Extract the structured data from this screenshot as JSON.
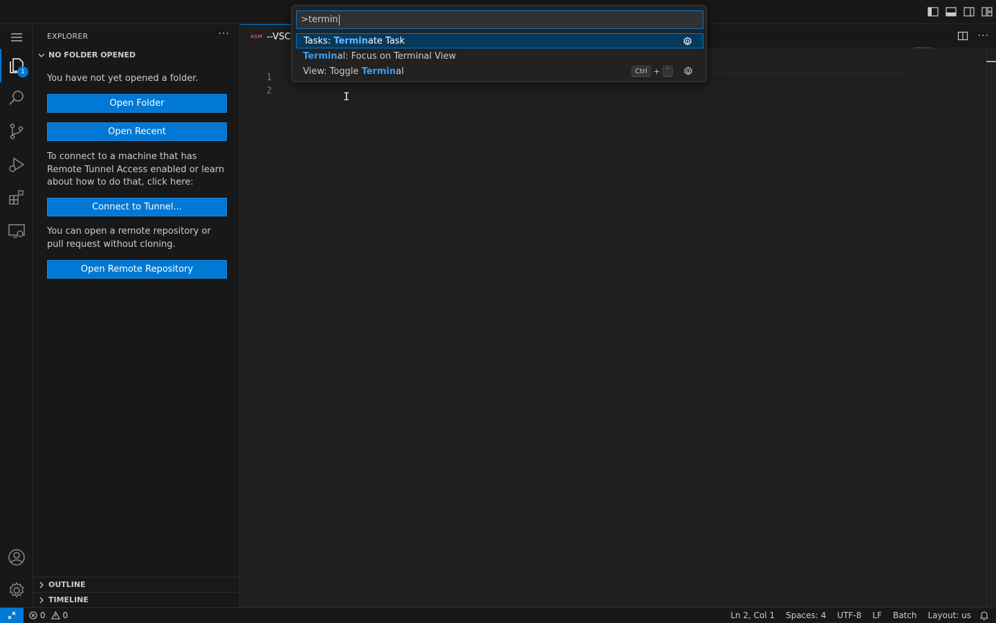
{
  "sidebar": {
    "title": "EXPLORER",
    "section_title": "NO FOLDER OPENED",
    "no_folder_text": "You have not yet opened a folder.",
    "open_folder_label": "Open Folder",
    "open_recent_label": "Open Recent",
    "tunnel_text": "To connect to a machine that has Remote Tunnel Access enabled or learn about how to do that, click here:",
    "connect_tunnel_label": "Connect to Tunnel...",
    "remote_repo_text": "You can open a remote repository or pull request without cloning.",
    "open_remote_repo_label": "Open Remote Repository",
    "outline_label": "OUTLINE",
    "timeline_label": "TIMELINE"
  },
  "activity": {
    "explorer_badge": "1"
  },
  "editor": {
    "tab_icon_text": "ASM",
    "tab_label": "--VSCO",
    "line_numbers": [
      "1",
      "2"
    ]
  },
  "palette": {
    "input_value": ">termin",
    "items": [
      {
        "prefix": "Tasks: ",
        "match": "Termin",
        "suffix": "ate Task",
        "selected": true
      },
      {
        "prefix": "",
        "match": "Termin",
        "suffix": "al: Focus on Terminal View",
        "selected": false
      },
      {
        "prefix": "View: Toggle ",
        "match": "Termin",
        "suffix": "al",
        "selected": false,
        "keybinding": [
          "Ctrl",
          "+",
          "`"
        ]
      }
    ]
  },
  "statusbar": {
    "errors": "0",
    "warnings": "0",
    "position": "Ln 2, Col 1",
    "spaces": "Spaces: 4",
    "encoding": "UTF-8",
    "eol": "LF",
    "language": "Batch",
    "layout": "Layout: us"
  },
  "colors": {
    "accent": "#0078d4",
    "match_highlight": "#3b9cf0"
  }
}
